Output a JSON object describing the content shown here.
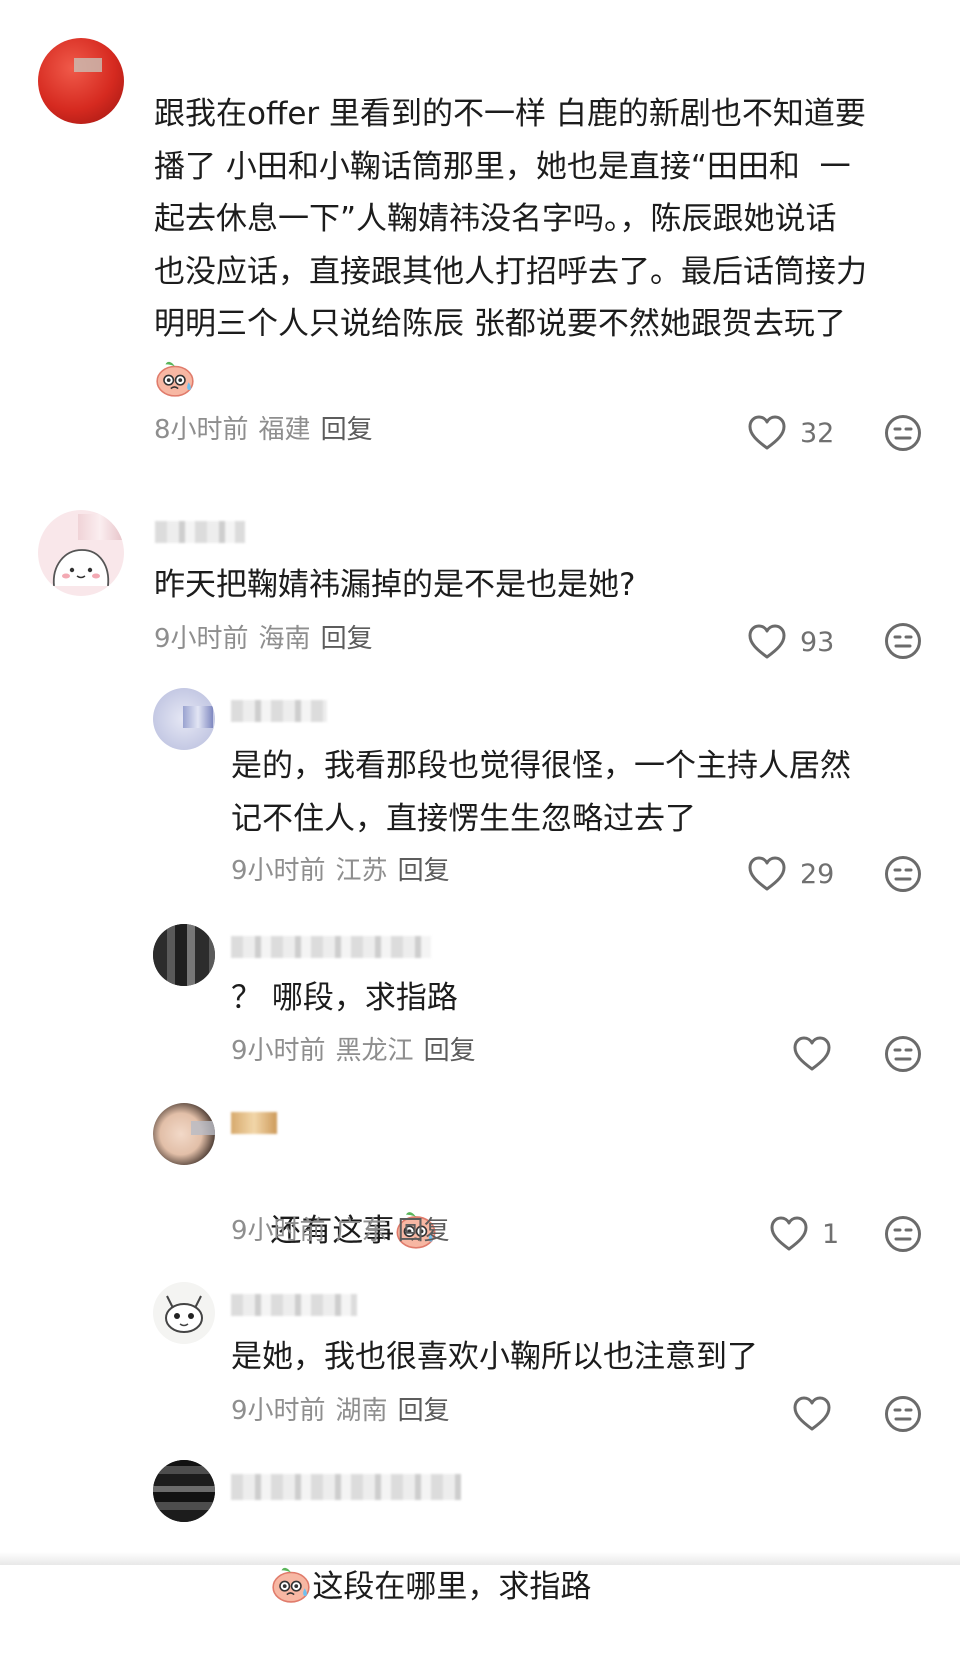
{
  "comments": [
    {
      "avatar_icon": "apple-avatar",
      "username": "",
      "text": "跟我在offer 里看到的不一样 白鹿的新剧也不知道要\n播了 小田和小鞠话筒那里，她也是直接“田田和  一\n起去休息一下”人鞠婧祎没名字吗。，陈辰跟她说话\n也没应话，直接跟其他人打招呼去了。最后话筒接力\n明明三个人只说给陈辰 张都说要不然她跟贺去玩了",
      "time": "8小时前",
      "location": "福建",
      "reply_label": "回复",
      "likes": "32"
    },
    {
      "avatar_icon": "cartoon-avatar",
      "username": "",
      "text": "昨天把鞠婧祎漏掉的是不是也是她?",
      "time": "9小时前",
      "location": "海南",
      "reply_label": "回复",
      "likes": "93"
    },
    {
      "avatar_icon": "blurred-avatar",
      "username": "",
      "text": "是的，我看那段也觉得很怪，一个主持人居然\n记不住人，直接愣生生忽略过去了",
      "time": "9小时前",
      "location": "江苏",
      "reply_label": "回复",
      "likes": "29"
    },
    {
      "avatar_icon": "blurred-avatar",
      "username": "",
      "text": "？ 哪段，求指路",
      "time": "9小时前",
      "location": "黑龙江",
      "reply_label": "回复",
      "likes": ""
    },
    {
      "avatar_icon": "photo-avatar",
      "username": "",
      "text": "还有这事",
      "time": "9小时前",
      "location": "广东",
      "reply_label": "回复",
      "likes": "1"
    },
    {
      "avatar_icon": "sketch-avatar",
      "username": "",
      "text": "是她，我也很喜欢小鞠所以也注意到了",
      "time": "9小时前",
      "location": "湖南",
      "reply_label": "回复",
      "likes": ""
    },
    {
      "avatar_icon": "blurred-avatar",
      "username": "",
      "text": "这段在哪里，求指路",
      "time": "",
      "location": "",
      "reply_label": "",
      "likes": ""
    }
  ],
  "colors": {
    "text": "#1c1c1c",
    "meta": "#8e8e8e",
    "icon": "#6b6b6b"
  }
}
